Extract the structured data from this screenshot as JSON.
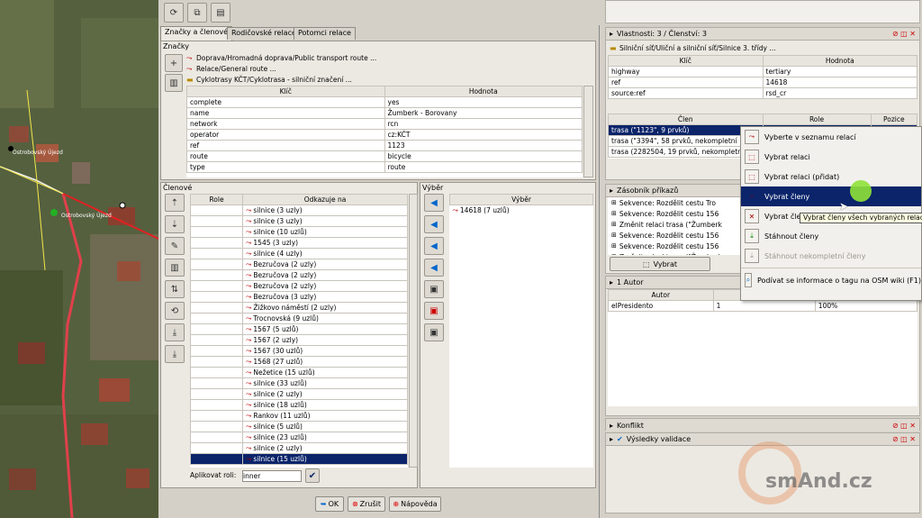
{
  "map": {
    "labels": [
      {
        "text": "Ostrobovský Újezd"
      },
      {
        "text": "Ostrobovský Újezd"
      }
    ]
  },
  "toolbar": {
    "icons": [
      "refresh-icon",
      "copy-icon",
      "database-icon"
    ]
  },
  "tabs": [
    {
      "label": "Značky a členové"
    },
    {
      "label": "Rodičovské relace"
    },
    {
      "label": "Potomci relace"
    }
  ],
  "tags_section": {
    "title": "Značky",
    "presets": [
      "Doprava/Hromadná doprava/Public transport route ...",
      "Relace/General route ...",
      "Cyklotrasy KČT/Cyklotrasa - silniční značení ..."
    ],
    "columns": [
      "Klíč",
      "Hodnota"
    ],
    "rows": [
      [
        "complete",
        "yes"
      ],
      [
        "name",
        "Žumberk - Borovany"
      ],
      [
        "network",
        "rcn"
      ],
      [
        "operator",
        "cz:KČT"
      ],
      [
        "ref",
        "1123"
      ],
      [
        "route",
        "bicycle"
      ],
      [
        "type",
        "route"
      ]
    ]
  },
  "members_section": {
    "title": "Členové",
    "columns": [
      "Role",
      "Odkazuje na"
    ],
    "rows": [
      "silnice (3 uzly)",
      "silnice (3 uzly)",
      "silnice (10 uzlů)",
      "1545 (3 uzly)",
      "silnice (4 uzly)",
      "Bezručova (2 uzly)",
      "Bezručova (2 uzly)",
      "Bezručova (2 uzly)",
      "Bezručova (3 uzly)",
      "Žižkovo náměstí (2 uzly)",
      "Trocnovská (9 uzlů)",
      "1567 (5 uzlů)",
      "1567 (2 uzly)",
      "1567 (30 uzlů)",
      "1568 (27 uzlů)",
      "Nežetice (15 uzlů)",
      "silnice (33 uzlů)",
      "silnice (2 uzly)",
      "silnice (18 uzlů)",
      "Rankov (11 uzlů)",
      "silnice (5 uzlů)",
      "silnice (23 uzlů)",
      "silnice (2 uzly)",
      "silnice (15 uzlů)"
    ],
    "apply_role_label": "Aplikovat roli:",
    "apply_role_value": "inner"
  },
  "selection_section": {
    "title": "Výběr",
    "column": "Výběr",
    "rows": [
      "14618 (7 uzlů)"
    ]
  },
  "bottom_buttons": {
    "ok": "OK",
    "cancel": "Zrušit",
    "help": "Nápověda"
  },
  "properties_panel": {
    "title": "Vlastnosti: 3 / Členství: 3",
    "preset": "Silniční síť/Uliční a silniční síť/Silnice 3. třídy ...",
    "columns": [
      "Klíč",
      "Hodnota"
    ],
    "rows": [
      [
        "highway",
        "tertiary"
      ],
      [
        "ref",
        "14618"
      ],
      [
        "source:ref",
        "rsd_cr"
      ]
    ],
    "member_columns": [
      "Člen",
      "Role",
      "Pozice"
    ],
    "member_rows": [
      "trasa (\"1123\", 9 prvků)",
      "trasa (\"3394\", 58 prvků, nekompletní",
      "trasa (2282504, 19 prvků, nekompletn"
    ]
  },
  "command_stack": {
    "title": "Zásobník příkazů",
    "rows": [
      "Sekvence: Rozdělit cestu Tro",
      "Sekvence: Rozdělit cestu 156",
      "Změnit relaci trasa (\"Žumberk",
      "Sekvence: Rozdělit cestu 156",
      "Sekvence: Rozdělit cestu 156",
      "Změnit relaci trasa (\"Žumberk"
    ],
    "select_button": "Vybrat"
  },
  "authors_panel": {
    "title": "1 Autor",
    "columns": [
      "Autor",
      "",
      ""
    ],
    "rows": [
      [
        "elPresidento",
        "1",
        "100%"
      ]
    ]
  },
  "conflict_panel": {
    "title": "Konflikt"
  },
  "validation_panel": {
    "title": "Výsledky validace"
  },
  "context_menu": {
    "items": [
      "Vyberte v seznamu relací",
      "Vybrat relaci",
      "Vybrat relaci (přidat)",
      "Vybrat členy",
      "Vybrat členy",
      "Stáhnout členy",
      "Stáhnout nekompletní členy",
      "Podívat se informace o tagu na OSM wiki (F1)"
    ],
    "tooltip": "Vybrat členy všech vybraných relací"
  },
  "watermark": "smAnd.cz"
}
